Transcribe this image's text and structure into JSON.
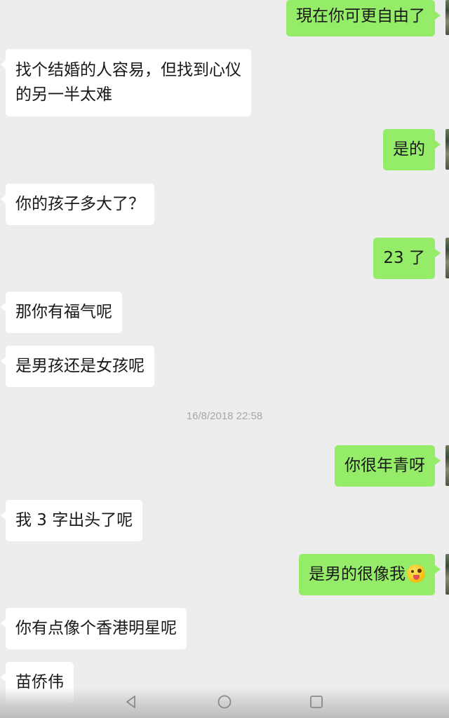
{
  "messages": [
    {
      "side": "right",
      "text": "現在你可更自由了"
    },
    {
      "side": "left",
      "line1": "找个结婚的人容易，但找到心仪",
      "line2": "的另一半太难"
    },
    {
      "side": "right",
      "text": "是的"
    },
    {
      "side": "left",
      "text": "你的孩子多大了？"
    },
    {
      "side": "right",
      "text": "23 了"
    },
    {
      "side": "left",
      "text": "那你有福气呢"
    },
    {
      "side": "left",
      "text": "是男孩还是女孩呢"
    },
    {
      "side": "right",
      "text": "你很年青呀"
    },
    {
      "side": "left",
      "text": "我 3 字出头了呢"
    },
    {
      "side": "right",
      "text": "是男的很像我",
      "emoji": "winking-face-tongue-emoji"
    },
    {
      "side": "left",
      "text": "你有点像个香港明星呢"
    },
    {
      "side": "left",
      "text": "苗侨伟"
    }
  ],
  "timestamp": "16/8/2018 22:58",
  "colors": {
    "background": "#ededed",
    "sent_bubble": "#95ec69",
    "received_bubble": "#ffffff",
    "timestamp_text": "#a8a8a8"
  },
  "nav": {
    "back_icon": "triangle-back-icon",
    "home_icon": "circle-home-icon",
    "recent_icon": "square-recent-icon"
  }
}
